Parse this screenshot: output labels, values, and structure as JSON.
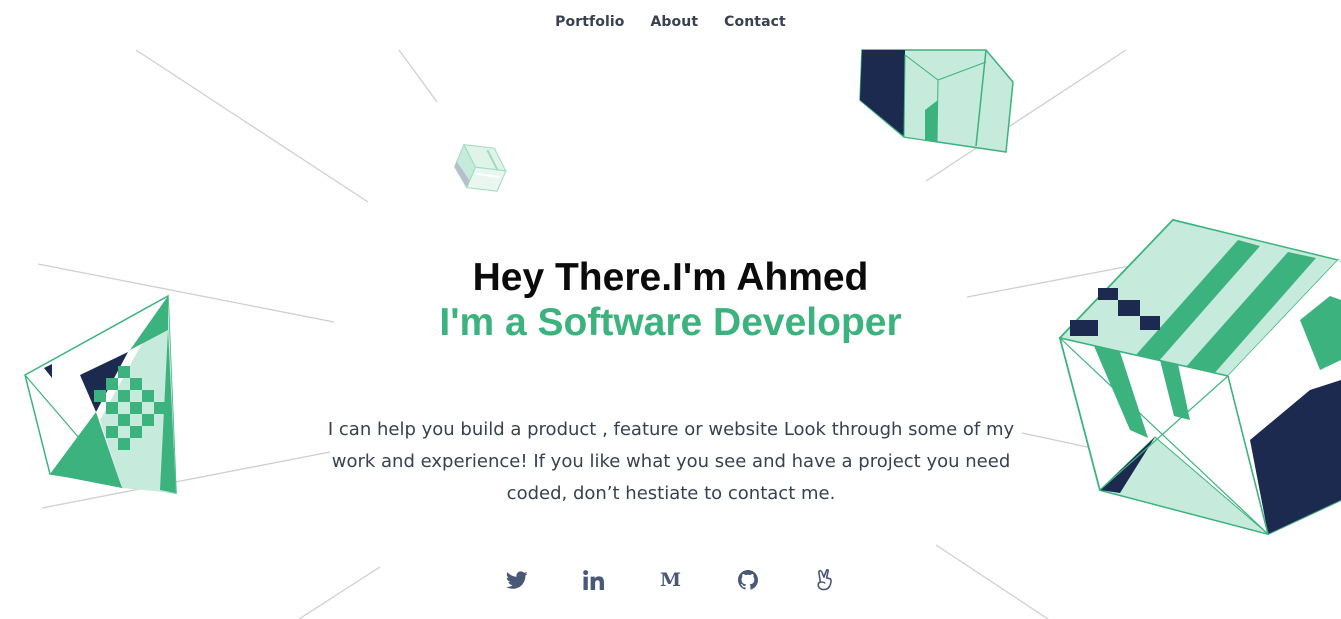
{
  "nav": {
    "items": [
      {
        "label": "Portfolio"
      },
      {
        "label": "About"
      },
      {
        "label": "Contact"
      }
    ]
  },
  "hero": {
    "title": "Hey There.I'm Ahmed",
    "subtitle": "I'm a Software Developer",
    "description": "I can help you build a product , feature or website Look through some of my work and experience! If you like what you see and have a project you need coded, don’t hestiate to contact me."
  },
  "socials": {
    "icons": [
      "twitter-icon",
      "linkedin-icon",
      "medium-icon",
      "github-icon",
      "angellist-icon"
    ],
    "medium_glyph": "M"
  },
  "colors": {
    "accent": "#3cb37e",
    "mint": "#c6eadb",
    "navy": "#1b2a4e",
    "icon": "#4a5878",
    "line": "#cfcfcf"
  }
}
